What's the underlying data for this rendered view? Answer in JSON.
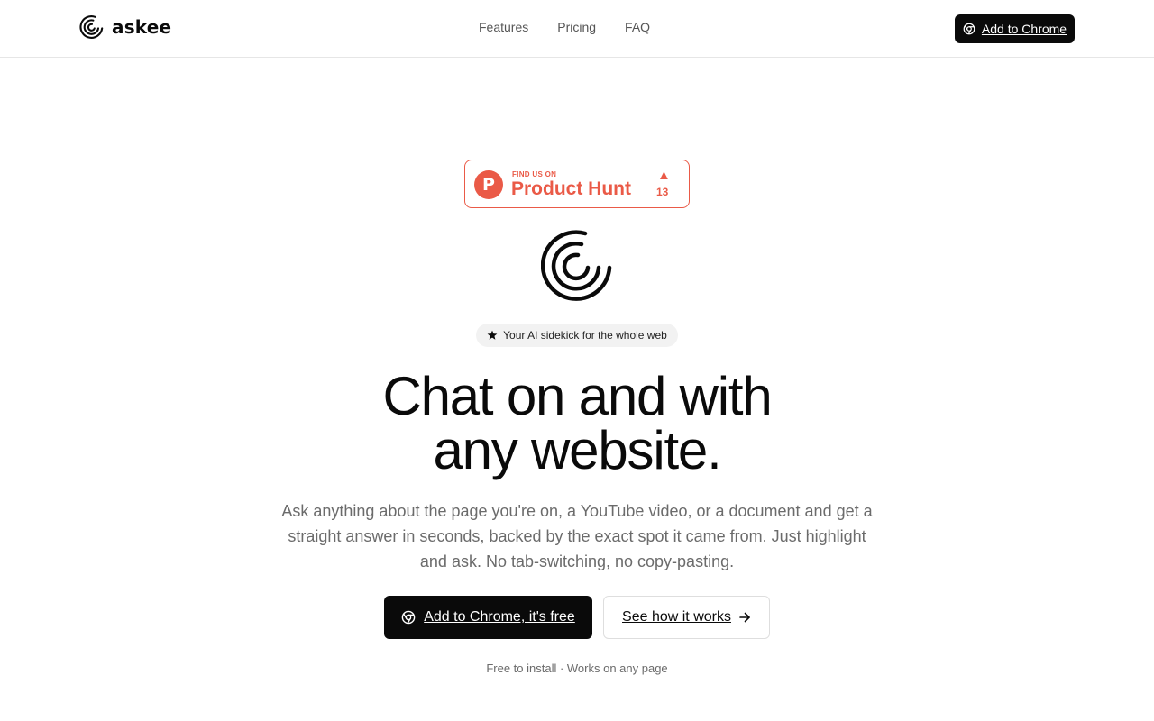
{
  "header": {
    "brand": "askee",
    "nav": [
      "Features",
      "Pricing",
      "FAQ"
    ],
    "cta_label": "Add to Chrome"
  },
  "product_hunt": {
    "kicker": "FIND US ON",
    "name": "Product Hunt",
    "letter": "P",
    "upvote_arrow": "▲",
    "upvotes": "13",
    "color": "#ea5a47"
  },
  "hero": {
    "tagline": "Your AI sidekick for the whole web",
    "headline_line1": "Chat on and with",
    "headline_line2": "any website.",
    "subtext": "Ask anything about the page you're on, a YouTube video, or a document and get a straight answer in seconds, backed by the exact spot it came from. Just highlight and ask. No tab-switching, no copy-pasting.",
    "primary_cta": "Add to Chrome, it's free",
    "secondary_cta": "See how it works",
    "footnote": "Free to install · Works on any page"
  },
  "icons": {
    "logo": "askee-swirl-logo",
    "chrome": "chrome-icon",
    "star": "star-icon",
    "arrow": "arrow-right-icon"
  },
  "colors": {
    "primary": "#0a0a0a",
    "muted_text": "#6b6b6b",
    "accent_product_hunt": "#ea5a47"
  }
}
